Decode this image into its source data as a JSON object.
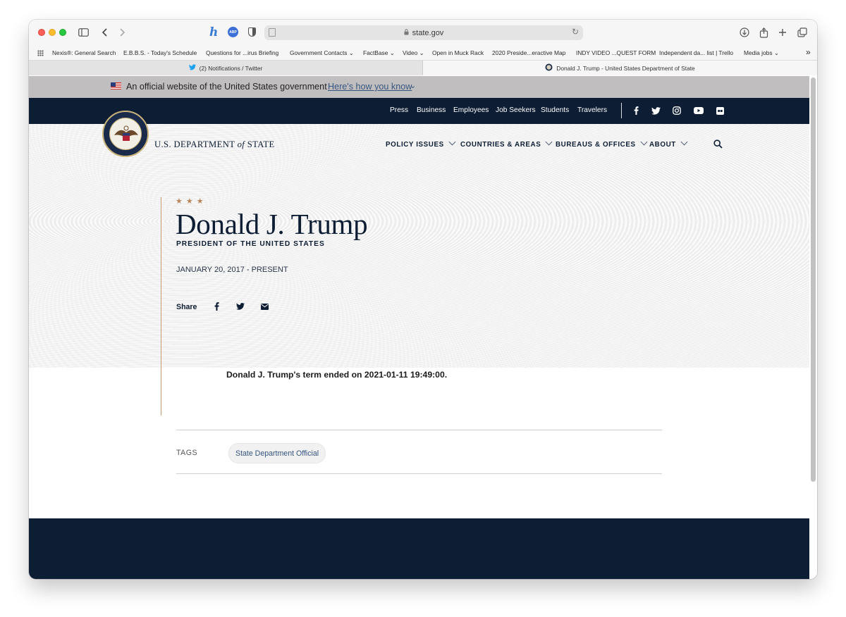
{
  "browser": {
    "url": "state.gov",
    "bookmarks": [
      "Nexis®: General Search",
      "E.B.B.S. - Today's Schedule",
      "Questions for ...irus Briefing",
      "Government Contacts ⌄",
      "FactBase ⌄",
      "Video ⌄",
      "Open in Muck Rack",
      "2020 Preside...eractive Map",
      "INDY VIDEO ...QUEST FORM",
      "Independent da... list | Trello",
      "Media jobs ⌄"
    ],
    "bookmarks_overflow": "»",
    "tabs": [
      {
        "label": "(2) Notifications / Twitter",
        "favicon": "twitter-icon"
      },
      {
        "label": "Donald J. Trump - United States Department of State",
        "favicon": "state-seal-icon"
      }
    ],
    "extension_h": "h",
    "extension_abp": "ABP"
  },
  "gov_banner": {
    "text": "An official website of the United States government",
    "link": "Here's how you know",
    "chevron": "⌄"
  },
  "utility_nav": {
    "links": [
      "Press",
      "Business",
      "Employees",
      "Job Seekers",
      "Students",
      "Travelers"
    ],
    "social_icons": [
      "facebook-icon",
      "twitter-icon",
      "instagram-icon",
      "youtube-icon",
      "flickr-icon"
    ]
  },
  "header": {
    "wordmark_pre": "U.S. DEPARTMENT ",
    "wordmark_of": "of",
    "wordmark_post": " STATE",
    "nav": [
      "POLICY ISSUES",
      "COUNTRIES & AREAS",
      "BUREAUS & OFFICES",
      "ABOUT"
    ]
  },
  "hero": {
    "stars": "★★★",
    "name": "Donald J. Trump",
    "title": "PRESIDENT OF THE UNITED STATES",
    "dates": "JANUARY 20, 2017 - PRESENT",
    "share_label": "Share"
  },
  "content": {
    "body": "Donald J. Trump's term ended on 2021-01-11 19:49:00.",
    "tags_label": "TAGS",
    "tags": [
      "State Department Official"
    ]
  },
  "colors": {
    "navy": "#0d1d33",
    "gov_banner_bg": "#c1bebf",
    "link_blue": "#35557f",
    "gold_accent": "#c39b74"
  }
}
